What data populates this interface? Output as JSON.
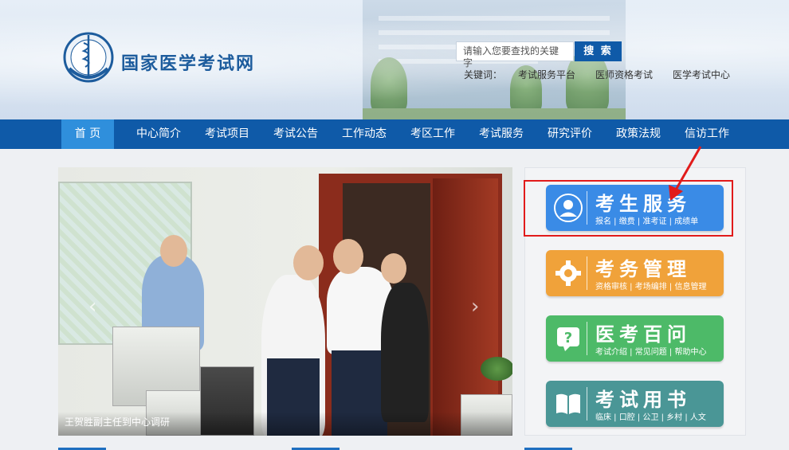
{
  "header": {
    "site_title": "国家医学考试网",
    "search_placeholder": "请输入您要查找的关键字",
    "search_button": "搜 索",
    "keywords_label": "关键词：",
    "keywords": [
      "考试服务平台",
      "医师资格考试",
      "医学考试中心"
    ]
  },
  "nav": {
    "items": [
      "首 页",
      "中心简介",
      "考试项目",
      "考试公告",
      "工作动态",
      "考区工作",
      "考试服务",
      "研究评价",
      "政策法规",
      "信访工作"
    ],
    "active_index": 0
  },
  "slider": {
    "caption": "王贺胜副主任到中心调研",
    "prev_icon": "chevron-left-icon",
    "next_icon": "chevron-right-icon"
  },
  "services": [
    {
      "title": "考生服务",
      "subtitle": "报名 | 缴费 | 准考证 | 成绩单",
      "icon": "user-icon",
      "color": "#3a8be6"
    },
    {
      "title": "考务管理",
      "subtitle": "资格审核 | 考场编排 | 信息管理",
      "icon": "gear-icon",
      "color": "#f0a23a"
    },
    {
      "title": "医考百问",
      "subtitle": "考试介绍 | 常见问题 | 帮助中心",
      "icon": "question-bubble-icon",
      "color": "#4dba68"
    },
    {
      "title": "考试用书",
      "subtitle": "临床 | 口腔 | 公卫 | 乡村 | 人文",
      "icon": "book-icon",
      "color": "#4a9696"
    }
  ],
  "colors": {
    "nav_bg": "#0f5aa8",
    "nav_active": "#2f8fdc",
    "highlight_box": "#e11b1b"
  }
}
